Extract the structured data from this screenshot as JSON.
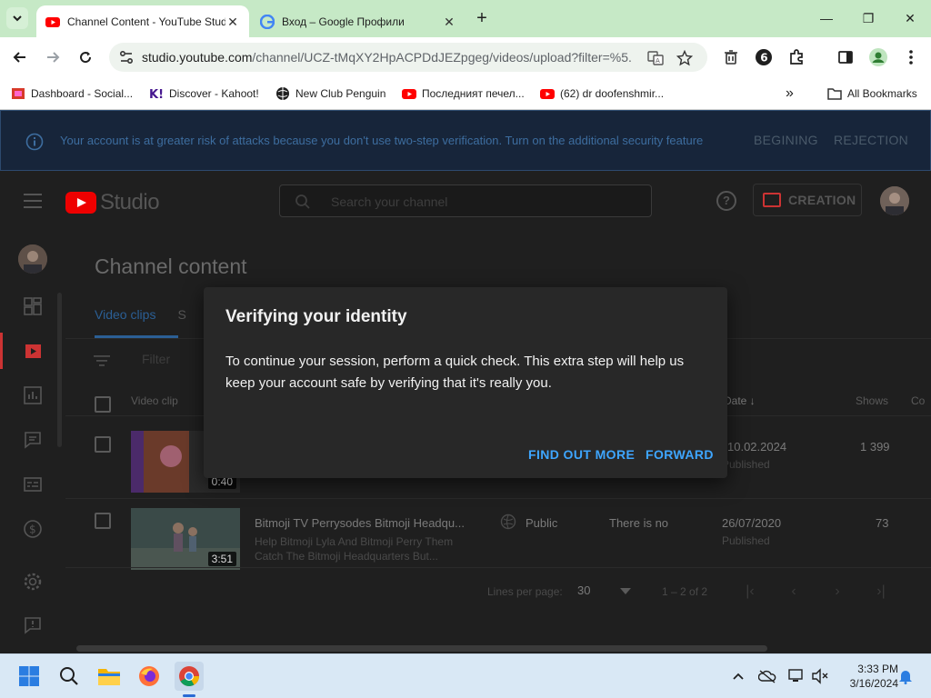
{
  "browser": {
    "tabs": [
      {
        "title": "Channel Content - YouTube Studio",
        "active": true
      },
      {
        "title": "Вход – Google Профили",
        "active": false
      }
    ],
    "url_host": "studio.youtube.com",
    "url_path": "/channel/UCZ-tMqXY2HpACPDdJEZpgeg/videos/upload?filter=%5...",
    "bookmarks": [
      {
        "label": "Dashboard - Social...",
        "icon": "bookmark-social-icon"
      },
      {
        "label": "Discover - Kahoot!",
        "icon": "kahoot-icon"
      },
      {
        "label": "New Club Penguin",
        "icon": "globe-icon"
      },
      {
        "label": "Последният печел...",
        "icon": "youtube-icon"
      },
      {
        "label": "(62) dr doofenshmir...",
        "icon": "youtube-icon"
      }
    ],
    "bookmarks_overflow": "»",
    "all_bookmarks": "All Bookmarks"
  },
  "banner": {
    "text": "Your account is at greater risk of attacks because you don't use two-step verification. Turn on the additional security feature",
    "btn_begin": "BEGINING",
    "btn_reject": "REJECTION"
  },
  "header": {
    "logo_text": "Studio",
    "search_placeholder": "Search your channel",
    "help": "?",
    "create_label": "CREATION"
  },
  "content": {
    "page_title": "Channel content",
    "tabs": [
      "Video clips",
      "S"
    ],
    "filter_placeholder": "Filter",
    "columns": {
      "video": "Video clip",
      "date": "Date ↓",
      "shows": "Shows",
      "comments": "Co"
    },
    "rows": [
      {
        "duration": "0:40",
        "date": "10.02.2024",
        "date_status": "Published",
        "shows": "1 399"
      },
      {
        "duration": "3:51",
        "title": "Bitmoji TV Perrysodes Bitmoji Headqu...",
        "description": "Help Bitmoji Lyla And Bitmoji Perry Them Catch The Bitmoji Headquarters But...",
        "visibility": "Public",
        "restrictions": "There is no",
        "date": "26/07/2020",
        "date_status": "Published",
        "shows": "73"
      }
    ],
    "pager": {
      "lines_per_page_label": "Lines per page:",
      "lines_per_page_value": "30",
      "range": "1 – 2 of 2"
    }
  },
  "dialog": {
    "title": "Verifying your identity",
    "body": "To continue your session, perform a quick check. This extra step will help us keep your account safe by verifying that it's really you.",
    "btn_learn": "FIND OUT MORE",
    "btn_forward": "FORWARD"
  },
  "taskbar": {
    "time": "3:33 PM",
    "date": "3/16/2024"
  }
}
